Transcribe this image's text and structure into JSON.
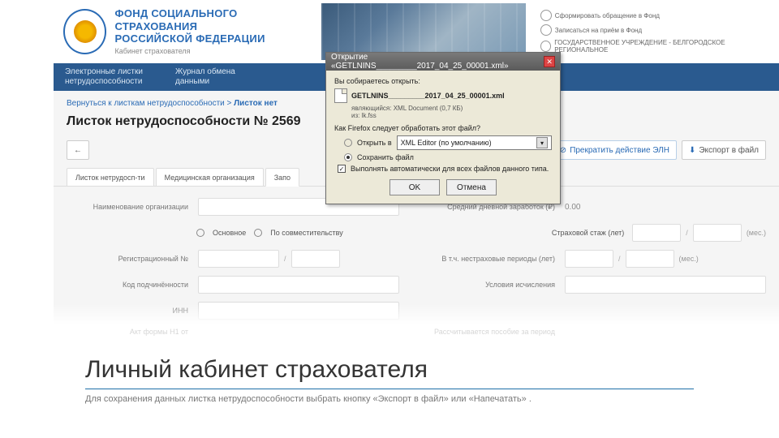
{
  "header": {
    "title_line1": "ФОНД СОЦИАЛЬНОГО СТРАХОВАНИЯ",
    "title_line2": "РОССИЙСКОЙ ФЕДЕРАЦИИ",
    "subtitle": "Кабинет страхователя",
    "links": [
      "Сформировать обращение в Фонд",
      "Записаться на приём в Фонд",
      "ГОСУДАРСТВЕННОЕ УЧРЕЖДЕНИЕ - БЕЛГОРОДСКОЕ РЕГИОНАЛЬНОЕ"
    ]
  },
  "nav": {
    "item1": "Электронные листки\nнетрудоспособности",
    "item2": "Журнал обмена\nданными"
  },
  "breadcrumb": {
    "back": "Вернуться к листкам нетрудоспособности",
    "sep": ">",
    "current": "Листок нет"
  },
  "page_title": "Листок нетрудоспособности № 2569",
  "toolbar": {
    "stop": "Прекратить действие ЭЛН",
    "export": "Экспорт в файл"
  },
  "tabs": {
    "t1": "Листок нетрудосп-ти",
    "t2": "Медицинская организация",
    "t3": "Запо"
  },
  "form": {
    "org_label": "Наименование организации",
    "daily_label": "Средний дневной заработок (₽)",
    "daily_value": "0.00",
    "radio_main": "Основное",
    "radio_sov": "По совместительству",
    "stazh_label": "Страховой стаж (лет)",
    "reg_label": "Регистрационный №",
    "nestrah_label": "В т.ч. нестраховые периоды (лет)",
    "kod_label": "Код подчинённости",
    "usl_label": "Условия исчисления",
    "inn_label": "ИНН",
    "mes": "(мес.)",
    "slash": "/",
    "akt_label": "Акт формы Н1 от",
    "period_label": "Рассчитывается пособие за период"
  },
  "dialog": {
    "title": "Открытие «GETLNINS_________2017_04_25_00001.xml»",
    "prompt": "Вы собираетесь открыть:",
    "filename": "GETLNINS_________2017_04_25_00001.xml",
    "type_line": "являющийся: XML Document (0,7 КБ)",
    "from_line": "из: lk.fss",
    "question": "Как Firefox следует обработать этот файл?",
    "open_with": "Открыть в",
    "app": "XML Editor (по умолчанию)",
    "save": "Сохранить файл",
    "auto": "Выполнять автоматически для всех файлов данного типа.",
    "ok": "OK",
    "cancel": "Отмена"
  },
  "slide": {
    "title": "Личный кабинет страхователя",
    "subtitle": "Для сохранения данных листка нетрудоспособности выбрать кнопку «Экспорт в файл» или «Напечатать» ."
  }
}
